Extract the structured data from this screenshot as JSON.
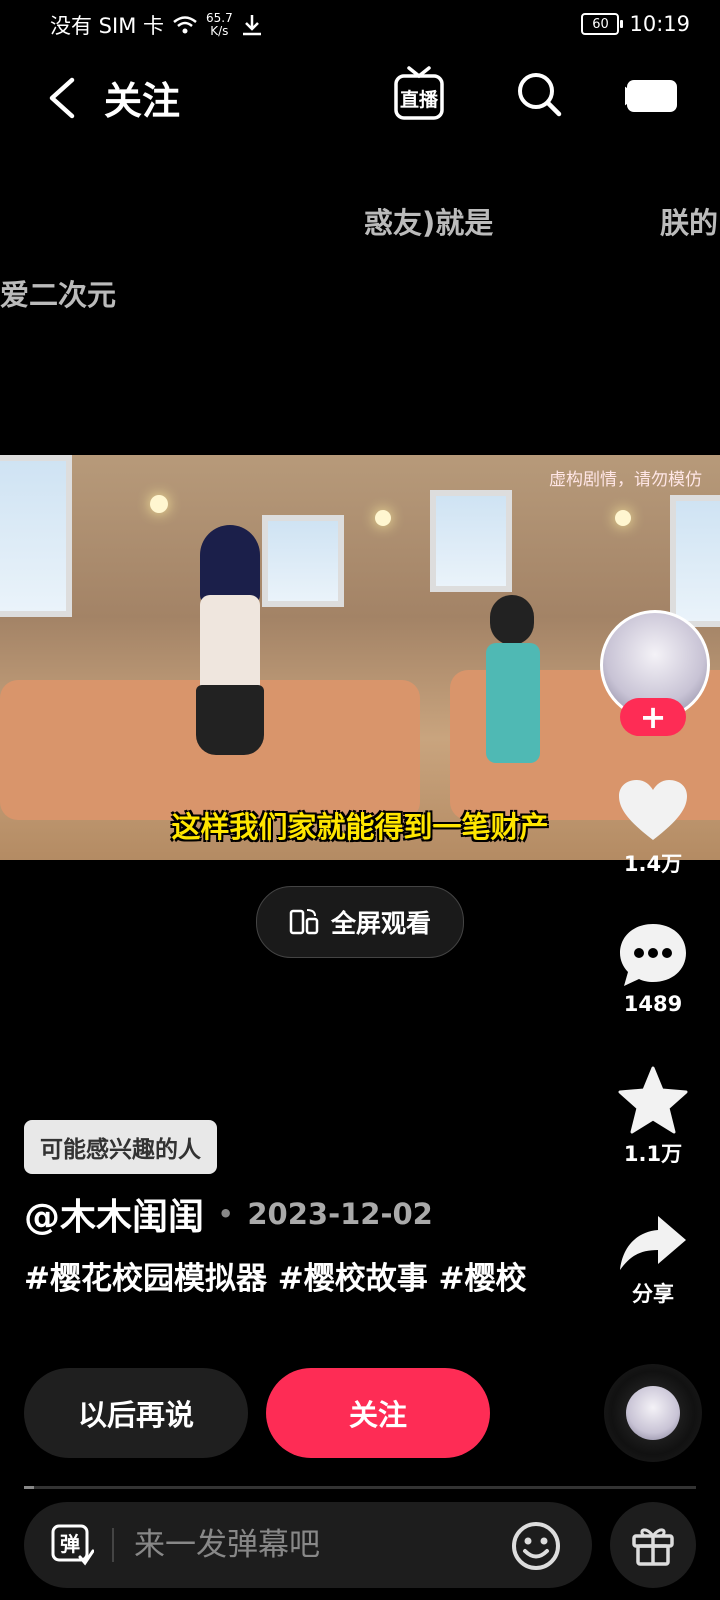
{
  "status_bar": {
    "carrier": "没有 SIM 卡",
    "net_speed_value": "65.7",
    "net_speed_unit": "K/s",
    "battery": "60",
    "time": "10:19"
  },
  "header": {
    "title": "关注",
    "live_label": "直播"
  },
  "danmaku": [
    "惑友)就是",
    "朕的",
    "爱二次元"
  ],
  "video": {
    "disclaimer": "虚构剧情，请勿模仿",
    "subtitle": "这样我们家就能得到一笔财产"
  },
  "fullscreen_label": "全屏观看",
  "rail": {
    "follow_plus": "+",
    "likes": "1.4万",
    "comments": "1489",
    "favorites": "1.1万",
    "share": "分享"
  },
  "info": {
    "tag": "可能感兴趣的人",
    "author": "@木木闺闺",
    "dot": "•",
    "date": "2023-12-02",
    "hashtags": "#樱花校园模拟器 #樱校故事 #樱校"
  },
  "actions": {
    "later": "以后再说",
    "follow": "关注"
  },
  "progress": 0.015,
  "comment_bar": {
    "danmaku_icon_char": "弹",
    "placeholder": "来一发弹幕吧"
  },
  "colors": {
    "accent": "#fe2c55",
    "subtitle": "#ffe600"
  }
}
